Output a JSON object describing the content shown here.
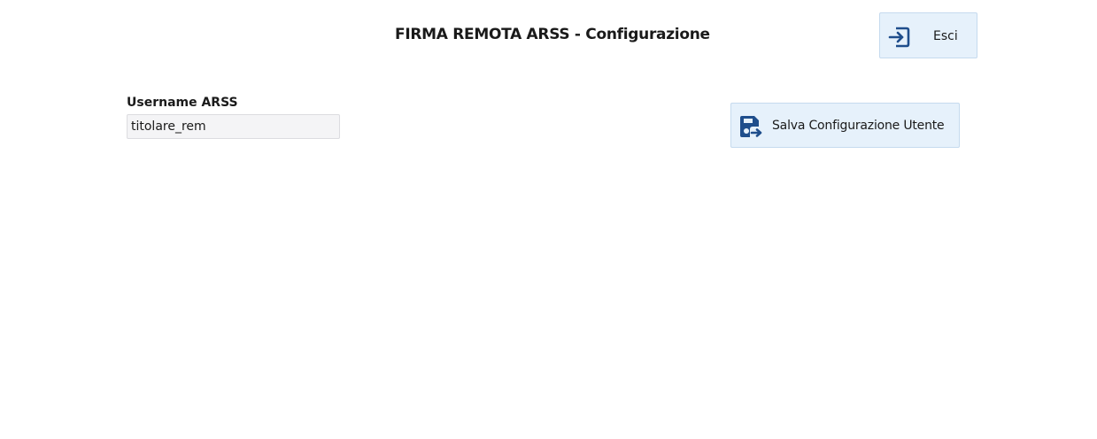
{
  "header": {
    "title": "FIRMA REMOTA ARSS - Configurazione"
  },
  "toolbar": {
    "exit_label": "Esci",
    "exit_icon": "exit-icon",
    "save_label": "Salva Configurazione Utente",
    "save_icon": "save-icon"
  },
  "form": {
    "username_label": "Username ARSS",
    "username_value": "titolare_rem"
  },
  "colors": {
    "accent": "#1f4e8c",
    "button_bg": "#e6f1fb",
    "input_bg": "#f4f4f6"
  }
}
